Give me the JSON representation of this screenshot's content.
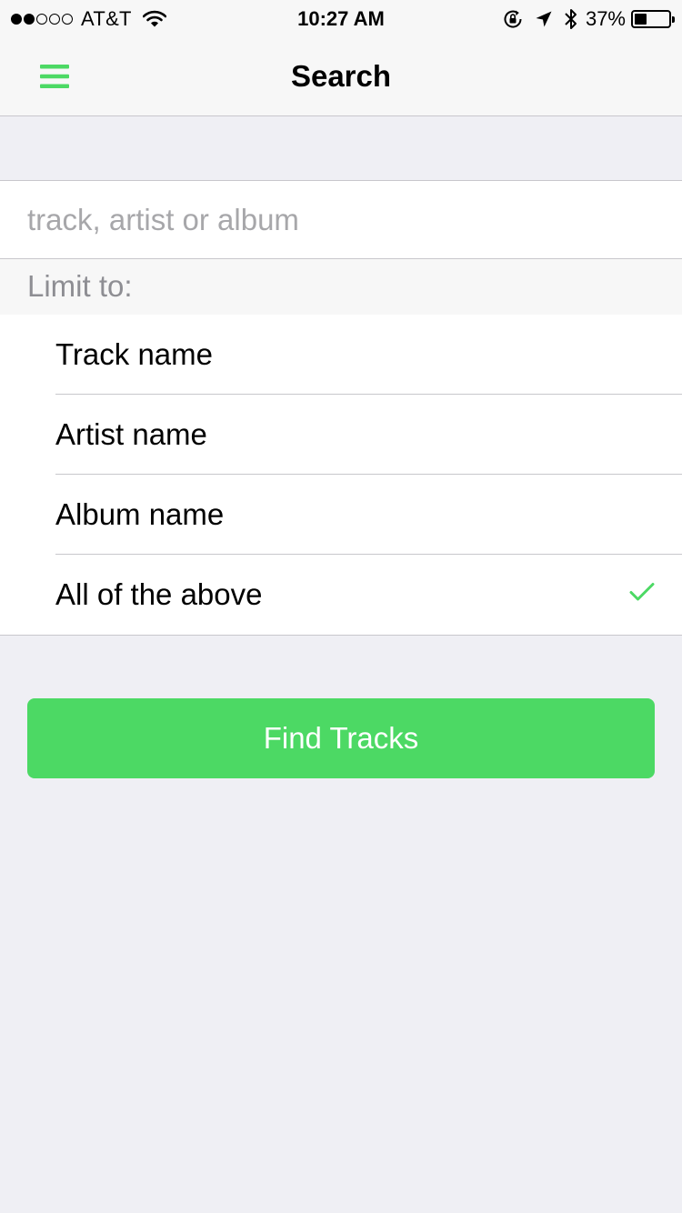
{
  "status_bar": {
    "signal_bars": 2,
    "signal_total": 5,
    "carrier": "AT&T",
    "time": "10:27 AM",
    "battery_percent": "37%",
    "battery_level": 0.37,
    "icons": [
      "wifi-icon",
      "rotation-lock-icon",
      "location-icon",
      "bluetooth-icon",
      "battery-icon"
    ]
  },
  "nav": {
    "title": "Search",
    "menu_icon": "hamburger-menu-icon"
  },
  "search": {
    "placeholder": "track, artist or album",
    "value": ""
  },
  "limit": {
    "header": "Limit to:",
    "options": [
      {
        "label": "Track name",
        "selected": false
      },
      {
        "label": "Artist name",
        "selected": false
      },
      {
        "label": "Album name",
        "selected": false
      },
      {
        "label": "All of the above",
        "selected": true
      }
    ]
  },
  "actions": {
    "find_label": "Find Tracks"
  },
  "colors": {
    "accent": "#4cd964",
    "background": "#efeff4",
    "separator": "#c8c7cc",
    "placeholder": "#a7a7aa",
    "section_header_text": "#8e8e93"
  }
}
